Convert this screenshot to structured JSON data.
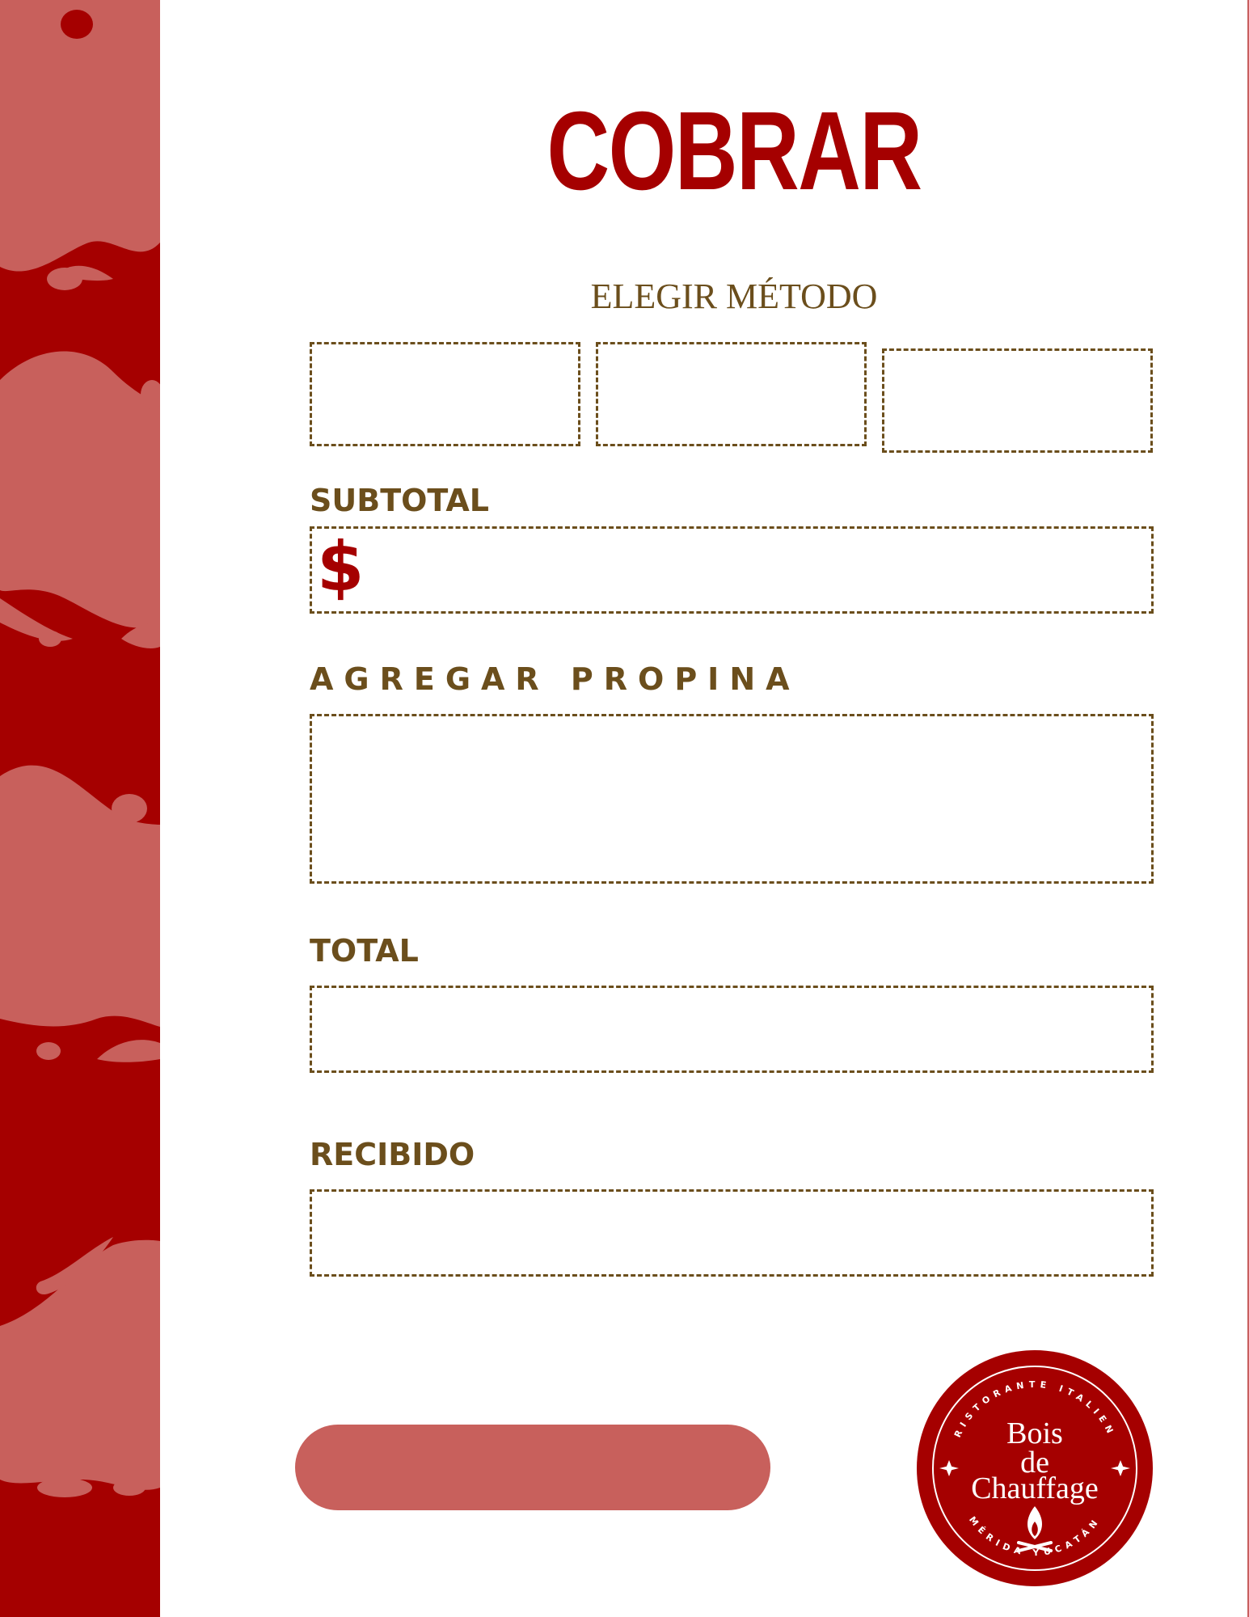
{
  "page": {
    "title": "COBRAR",
    "method_label": "ELEGIR MÉTODO",
    "method_options": [
      "",
      "",
      ""
    ]
  },
  "fields": {
    "subtotal": {
      "label": "SUBTOTAL",
      "currency_symbol": "$",
      "value": ""
    },
    "tip": {
      "label": "AGREGAR PROPINA",
      "value": ""
    },
    "total": {
      "label": "TOTAL",
      "value": ""
    },
    "received": {
      "label": "RECIBIDO",
      "value": ""
    }
  },
  "action": {
    "button_label": ""
  },
  "logo": {
    "top_text": "RISTORANTE ITALIEN",
    "name_line1": "Bois",
    "name_line2": "de",
    "name_line3": "Chauffage",
    "bottom_text": "MÉRIDA YUCATÁN"
  },
  "colors": {
    "brand_red": "#a50000",
    "light_red": "#c8605c",
    "brown": "#6b4e1c"
  }
}
